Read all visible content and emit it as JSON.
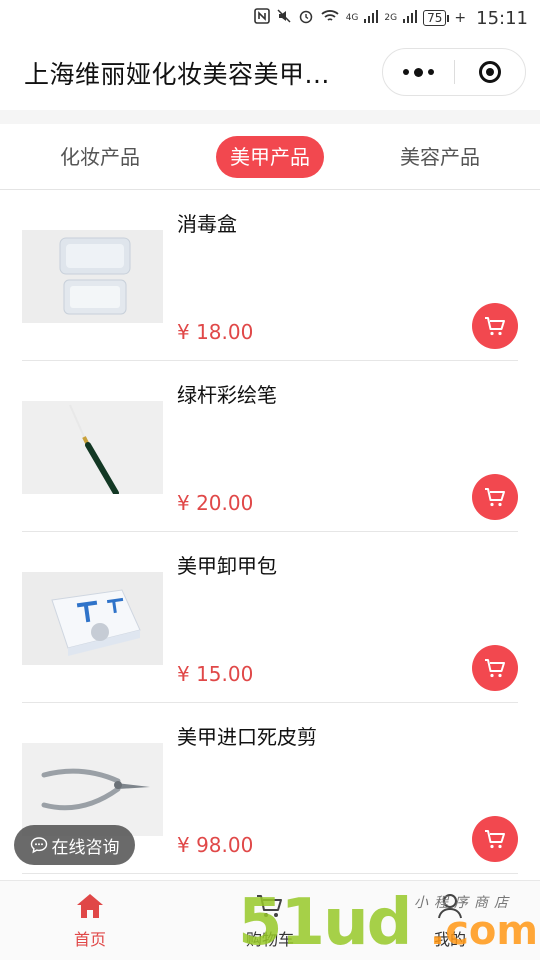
{
  "status_bar": {
    "net1": "4G",
    "net2": "2G",
    "battery": "75",
    "time": "15:11"
  },
  "header": {
    "title": "上海维丽娅化妆美容美甲..."
  },
  "tabs": [
    {
      "label": "化妆产品",
      "active": false
    },
    {
      "label": "美甲产品",
      "active": true
    },
    {
      "label": "美容产品",
      "active": false
    }
  ],
  "products": [
    {
      "name": "消毒盒",
      "price": "¥ 18.00"
    },
    {
      "name": "绿杆彩绘笔",
      "price": "¥ 20.00"
    },
    {
      "name": "美甲卸甲包",
      "price": "¥ 15.00"
    },
    {
      "name": "美甲进口死皮剪",
      "price": "¥ 98.00"
    }
  ],
  "consult": {
    "label": "在线咨询"
  },
  "bottom_nav": [
    {
      "label": "首页",
      "icon": "home-icon",
      "active": true
    },
    {
      "label": "购物车",
      "icon": "cart-icon",
      "active": false
    },
    {
      "label": "我的",
      "icon": "user-icon",
      "active": false
    }
  ],
  "watermark": {
    "main": "51ud",
    "suffix": ".com",
    "tagline": "小程序商店"
  },
  "colors": {
    "accent": "#f2484f",
    "price": "#e04848"
  }
}
